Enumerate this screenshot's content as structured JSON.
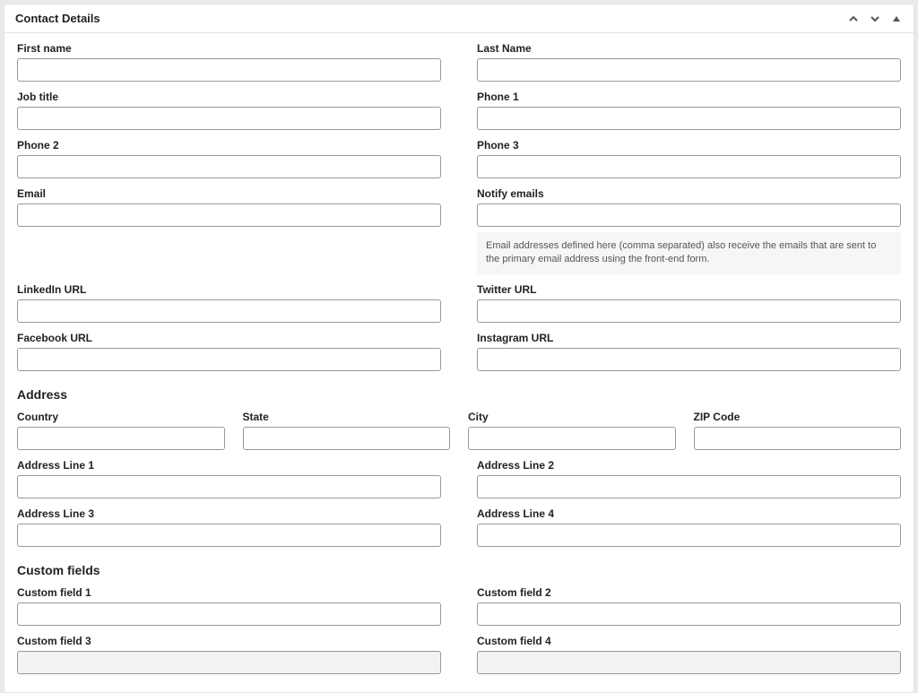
{
  "panel": {
    "title": "Contact Details"
  },
  "contact": {
    "first_name": {
      "label": "First name",
      "value": ""
    },
    "last_name": {
      "label": "Last Name",
      "value": ""
    },
    "job_title": {
      "label": "Job title",
      "value": ""
    },
    "phone1": {
      "label": "Phone 1",
      "value": ""
    },
    "phone2": {
      "label": "Phone 2",
      "value": ""
    },
    "phone3": {
      "label": "Phone 3",
      "value": ""
    },
    "email": {
      "label": "Email",
      "value": ""
    },
    "notify": {
      "label": "Notify emails",
      "value": "",
      "help": "Email addresses defined here (comma separated) also receive the emails that are sent to the primary email address using the front-end form."
    },
    "linkedin": {
      "label": "LinkedIn URL",
      "value": ""
    },
    "twitter": {
      "label": "Twitter URL",
      "value": ""
    },
    "facebook": {
      "label": "Facebook URL",
      "value": ""
    },
    "instagram": {
      "label": "Instagram URL",
      "value": ""
    }
  },
  "address": {
    "heading": "Address",
    "country": {
      "label": "Country",
      "value": ""
    },
    "state": {
      "label": "State",
      "value": ""
    },
    "city": {
      "label": "City",
      "value": ""
    },
    "zip": {
      "label": "ZIP Code",
      "value": ""
    },
    "line1": {
      "label": "Address Line 1",
      "value": ""
    },
    "line2": {
      "label": "Address Line 2",
      "value": ""
    },
    "line3": {
      "label": "Address Line 3",
      "value": ""
    },
    "line4": {
      "label": "Address Line 4",
      "value": ""
    }
  },
  "custom": {
    "heading": "Custom fields",
    "f1": {
      "label": "Custom field 1",
      "value": ""
    },
    "f2": {
      "label": "Custom field 2",
      "value": ""
    },
    "f3": {
      "label": "Custom field 3",
      "value": ""
    },
    "f4": {
      "label": "Custom field 4",
      "value": ""
    }
  }
}
